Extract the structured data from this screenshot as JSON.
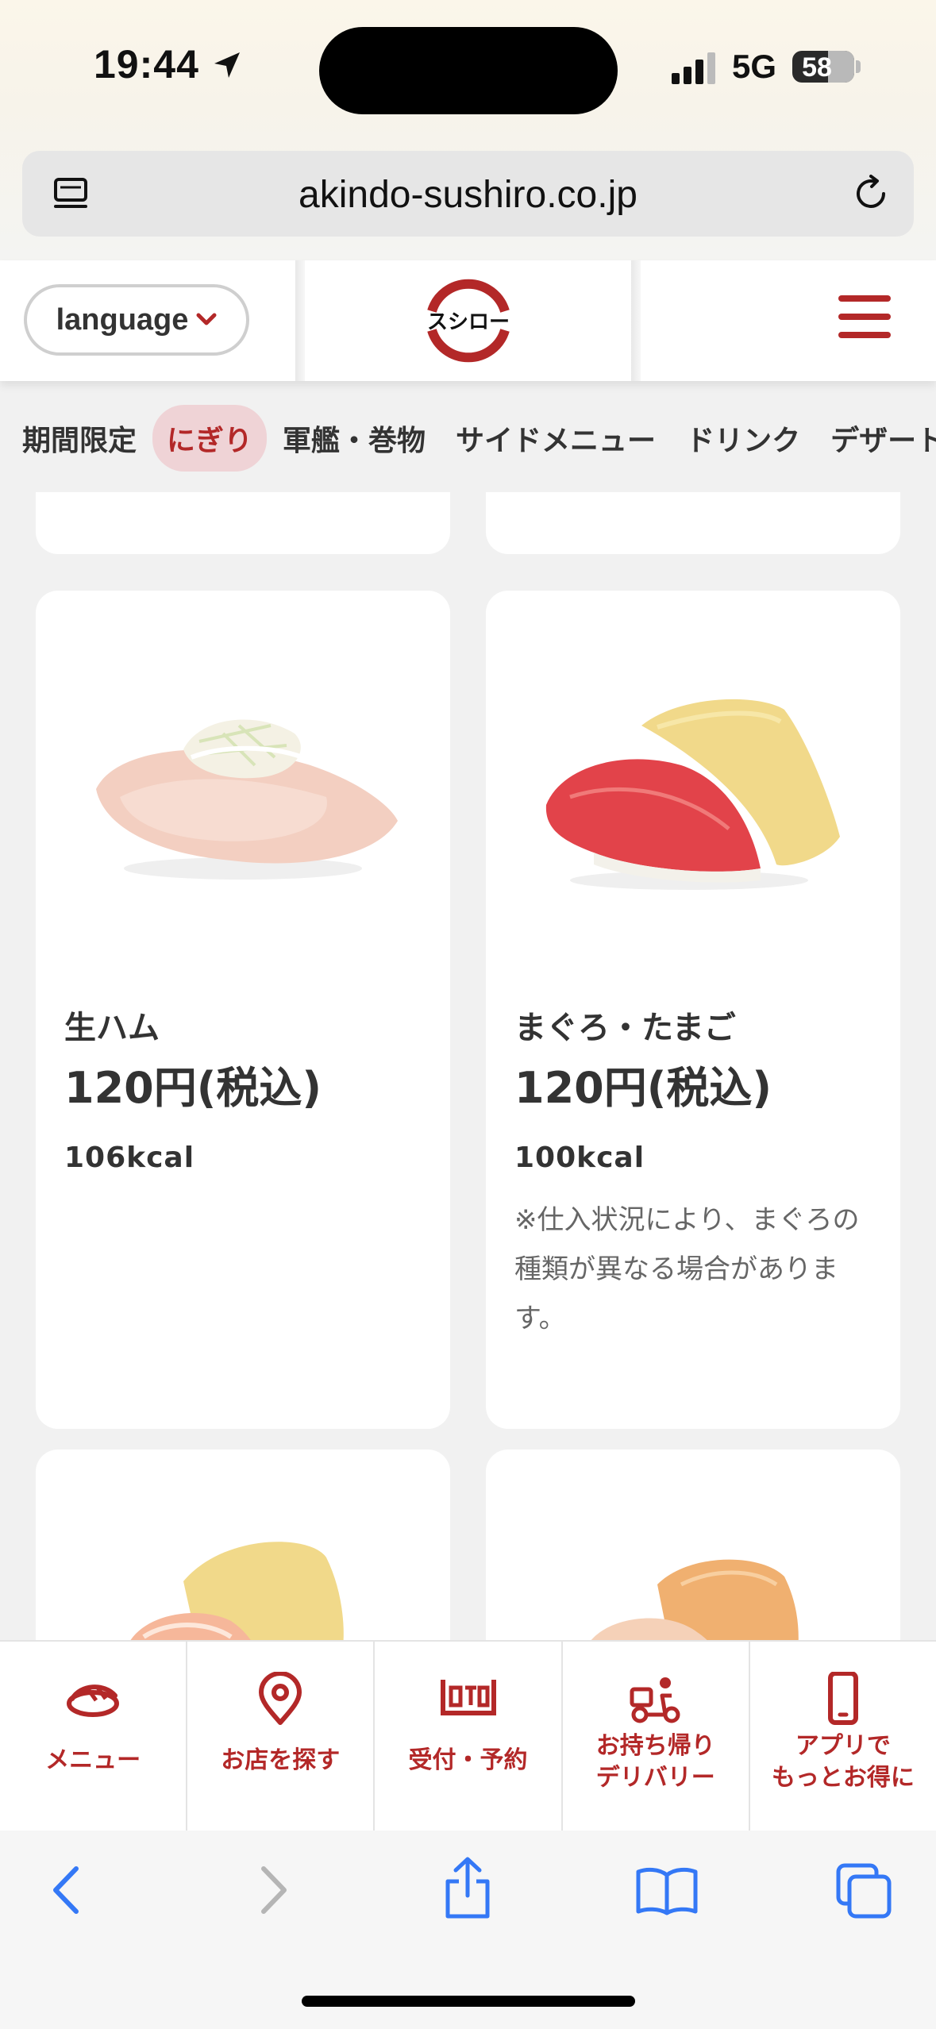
{
  "status": {
    "time": "19:44",
    "network": "5G",
    "battery": "58",
    "battery_level": 0.58
  },
  "browser": {
    "url": "akindo-sushiro.co.jp"
  },
  "header": {
    "language_label": "language",
    "logo_text": "スシロー"
  },
  "categories": [
    {
      "label": "期間限定",
      "active": false
    },
    {
      "label": "にぎり",
      "active": true
    },
    {
      "label": "軍艦・巻物",
      "active": false
    },
    {
      "label": "サイドメニュー",
      "active": false
    },
    {
      "label": "ドリンク",
      "active": false
    },
    {
      "label": "デザート",
      "active": false
    }
  ],
  "items": [
    {
      "name": "生ハム",
      "price": "120円(税込)",
      "kcal": "106kcal",
      "note": ""
    },
    {
      "name": "まぐろ・たまご",
      "price": "120円(税込)",
      "kcal": "100kcal",
      "note": "※仕入状況により、まぐろの種類が異なる場合があります。"
    }
  ],
  "nav": [
    {
      "label": "メニュー",
      "icon": "sushi-icon"
    },
    {
      "label": "お店を探す",
      "icon": "map-pin-icon"
    },
    {
      "label": "受付・予約",
      "icon": "reception-icon"
    },
    {
      "label": "お持ち帰り\nデリバリー",
      "icon": "delivery-scooter-icon"
    },
    {
      "label": "アプリで\nもっとお得に",
      "icon": "smartphone-icon"
    }
  ],
  "colors": {
    "brand": "#b32828",
    "active_tab_bg": "#efd3d6",
    "ios_blue": "#3478f6"
  }
}
